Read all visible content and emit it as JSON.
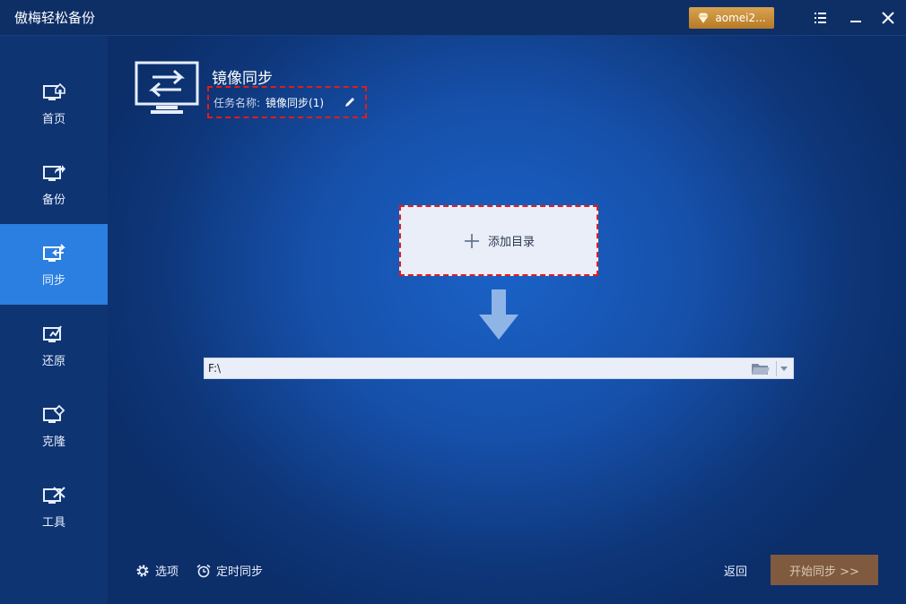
{
  "titlebar": {
    "app_title": "傲梅轻松备份",
    "user_label": "aomei2..."
  },
  "sidebar": {
    "items": [
      {
        "label": "首页",
        "icon": "home-monitor-icon"
      },
      {
        "label": "备份",
        "icon": "backup-monitor-icon"
      },
      {
        "label": "同步",
        "icon": "sync-monitor-icon",
        "active": true
      },
      {
        "label": "还原",
        "icon": "restore-monitor-icon"
      },
      {
        "label": "克隆",
        "icon": "clone-monitor-icon"
      },
      {
        "label": "工具",
        "icon": "tools-monitor-icon"
      }
    ]
  },
  "task": {
    "title": "镜像同步",
    "name_label": "任务名称:",
    "name_value": "镜像同步(1)"
  },
  "source": {
    "add_label": "添加目录"
  },
  "destination": {
    "value": "F:\\"
  },
  "footer": {
    "options_label": "选项",
    "schedule_label": "定时同步",
    "back_label": "返回",
    "start_label": "开始同步 >>"
  },
  "colors": {
    "active_nav": "#2b7fe0",
    "start_button": "#7f5a3e",
    "dashed_highlight": "#e21b1b",
    "user_badge": "#c98d38"
  }
}
